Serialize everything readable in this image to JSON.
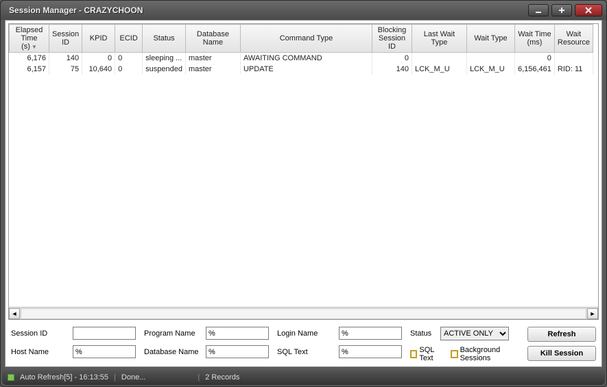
{
  "window": {
    "title": "Session Manager - CRAZYCHOON"
  },
  "grid": {
    "columns": [
      {
        "label": "Elapsed Time (s)",
        "w": 58,
        "sorted": true
      },
      {
        "label": "Session ID",
        "w": 48
      },
      {
        "label": "KPID",
        "w": 48
      },
      {
        "label": "ECID",
        "w": 40
      },
      {
        "label": "Status",
        "w": 62
      },
      {
        "label": "Database Name",
        "w": 80
      },
      {
        "label": "Command Type",
        "w": 192
      },
      {
        "label": "Blocking Session ID",
        "w": 58
      },
      {
        "label": "Last Wait Type",
        "w": 80
      },
      {
        "label": "Wait Type",
        "w": 70
      },
      {
        "label": "Wait Time (ms)",
        "w": 56
      },
      {
        "label": "Wait Resource",
        "w": 48
      }
    ],
    "rows": [
      {
        "elapsed": "6,176",
        "session": "140",
        "kpid": "0",
        "ecid": "0",
        "status": "sleeping  ...",
        "db": "master",
        "cmd": "AWAITING COMMAND",
        "block": "0",
        "lastwait": "",
        "wait": "",
        "waitms": "0",
        "waitres": ""
      },
      {
        "elapsed": "6,157",
        "session": "75",
        "kpid": "10,640",
        "ecid": "0",
        "status": "suspended",
        "db": "master",
        "cmd": "UPDATE",
        "block": "140",
        "lastwait": "LCK_M_U",
        "wait": "LCK_M_U",
        "waitms": "6,156,461",
        "waitres": "RID: 11"
      }
    ]
  },
  "filters": {
    "session_id": {
      "label": "Session ID",
      "value": ""
    },
    "host_name": {
      "label": "Host Name",
      "value": "%"
    },
    "program_name": {
      "label": "Program Name",
      "value": "%"
    },
    "database_name": {
      "label": "Database Name",
      "value": "%"
    },
    "login_name": {
      "label": "Login Name",
      "value": "%"
    },
    "sql_text_filter": {
      "label": "SQL Text",
      "value": "%"
    },
    "status": {
      "label": "Status",
      "selected": "ACTIVE ONLY"
    },
    "chk_sql_text": "SQL Text",
    "chk_bg": "Background Sessions"
  },
  "buttons": {
    "refresh": "Refresh",
    "kill": "Kill Session"
  },
  "statusbar": {
    "auto": "Auto Refresh[5] - 16:13:55",
    "done": "Done...",
    "records": "2 Records"
  }
}
